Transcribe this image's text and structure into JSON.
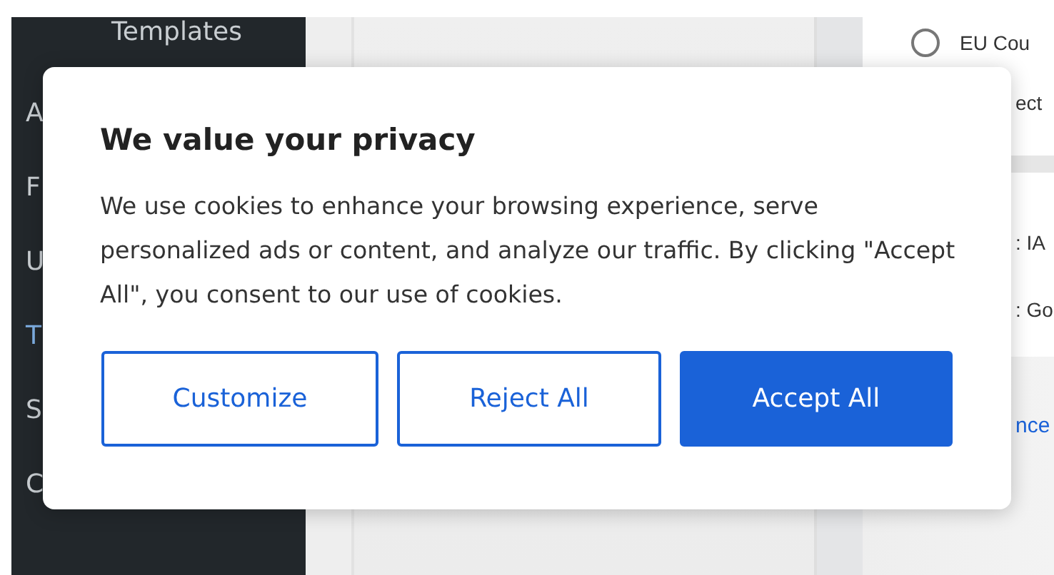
{
  "sidebar": {
    "items": [
      {
        "label": "Templates",
        "selected": false
      },
      {
        "label": "A",
        "selected": false
      },
      {
        "label": "F",
        "selected": false
      },
      {
        "label": "U",
        "selected": false
      },
      {
        "label": "T",
        "selected": true
      },
      {
        "label": "S",
        "selected": false
      },
      {
        "label": "C",
        "selected": false
      }
    ]
  },
  "right_panel": {
    "radio": {
      "label": "EU Cou",
      "selected": false
    },
    "texts": [
      "ect",
      ": IA",
      ": Go"
    ],
    "link": "nce"
  },
  "dialog": {
    "title": "We value your privacy",
    "message": "We use cookies to enhance your browsing experience, serve personalized ads or content, and analyze our traffic. By clicking \"Accept All\", you consent to our use of cookies.",
    "buttons": [
      {
        "label": "Customize",
        "kind": "outline"
      },
      {
        "label": "Reject All",
        "kind": "outline"
      },
      {
        "label": "Accept All",
        "kind": "primary"
      }
    ]
  }
}
